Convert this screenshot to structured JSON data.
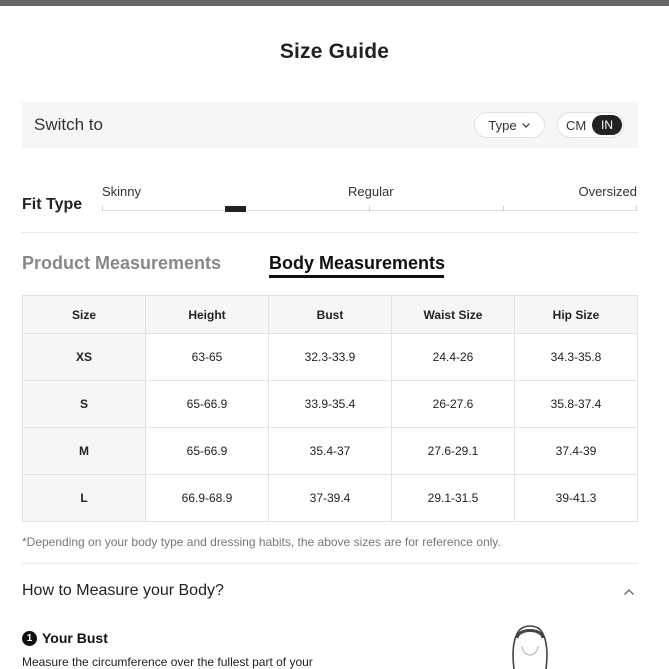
{
  "title": "Size Guide",
  "switch_bar": {
    "label": "Switch to",
    "type_label": "Type",
    "unit_cm": "CM",
    "unit_in": "IN"
  },
  "fit_type": {
    "label": "Fit Type",
    "options": [
      "Skinny",
      "Regular",
      "Oversized"
    ]
  },
  "tabs": {
    "product": "Product Measurements",
    "body": "Body Measurements"
  },
  "table": {
    "headers": [
      "Size",
      "Height",
      "Bust",
      "Waist Size",
      "Hip Size"
    ],
    "rows": [
      [
        "XS",
        "63-65",
        "32.3-33.9",
        "24.4-26",
        "34.3-35.8"
      ],
      [
        "S",
        "65-66.9",
        "33.9-35.4",
        "26-27.6",
        "35.8-37.4"
      ],
      [
        "M",
        "65-66.9",
        "35.4-37",
        "27.6-29.1",
        "37.4-39"
      ],
      [
        "L",
        "66.9-68.9",
        "37-39.4",
        "29.1-31.5",
        "39-41.3"
      ]
    ]
  },
  "note": "*Depending on your body type and dressing habits, the above sizes are for reference only.",
  "how_to_measure": {
    "title": "How to Measure your Body?",
    "step_number": "1",
    "bust_title": "Your Bust",
    "bust_desc": "Measure the circumference over the fullest part of your"
  },
  "icons": {
    "type_dropdown": "chevron-down-icon",
    "collapse": "chevron-up-icon",
    "figure": "body-figure-icon"
  }
}
